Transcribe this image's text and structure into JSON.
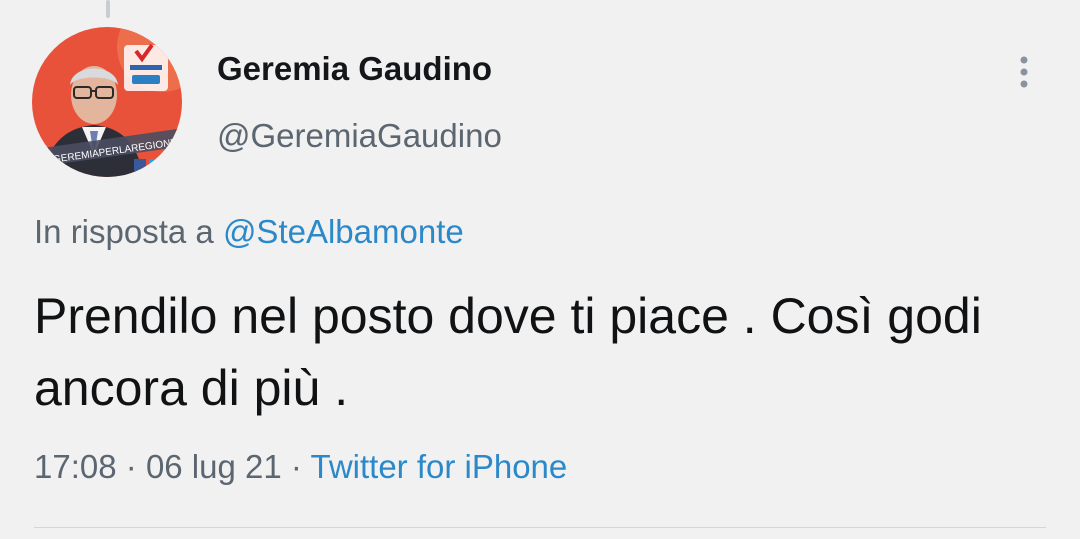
{
  "thread": {
    "connector": true
  },
  "author": {
    "display_name": "Geremia Gaudino",
    "handle": "@GeremiaGaudino",
    "avatar_icon": "profile-photo-icon",
    "avatar_banner_text": "GEREMIAPERLAREGIONE"
  },
  "menu": {
    "icon": "more-vertical-icon"
  },
  "reply": {
    "prefix": "In risposta a",
    "mention": "@SteAlbamonte"
  },
  "tweet": {
    "text": "Prendilo nel posto dove ti piace . Così godi ancora di più ."
  },
  "meta": {
    "time": "17:08",
    "separator": "·",
    "date": "06 lug 21",
    "source": "Twitter for iPhone"
  },
  "colors": {
    "background": "#f1f1f1",
    "link": "#2b89c9",
    "secondary_text": "#5b6671",
    "primary_text": "#141619",
    "avatar_bg": "#e8523a"
  }
}
